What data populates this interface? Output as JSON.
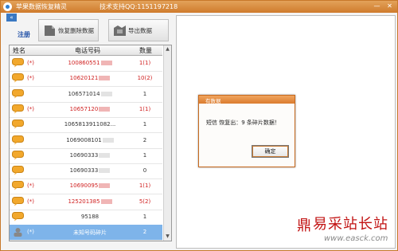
{
  "window": {
    "title": "苹果数据恢复精灵",
    "support": "技术支持QQ:1151197218",
    "minimize_glyph": "—",
    "close_glyph": "✕"
  },
  "toolbar": {
    "collapse_glyph": "«",
    "register_label": "注册",
    "restore_label": "恢复删除数据",
    "export_label": "导出数据"
  },
  "table": {
    "headers": [
      "姓名",
      "电话号码",
      "数量"
    ],
    "rows": [
      {
        "flag": "(*)",
        "phone": "100860551",
        "count": "1(1)",
        "red": true,
        "selected": false
      },
      {
        "flag": "(*)",
        "phone": "10620121",
        "count": "10(2)",
        "red": true,
        "selected": false
      },
      {
        "flag": "",
        "phone": "106571014",
        "count": "1",
        "red": false,
        "selected": false
      },
      {
        "flag": "(*)",
        "phone": "10657120",
        "count": "1(1)",
        "red": true,
        "selected": false
      },
      {
        "flag": "",
        "phone": "1065813911082...",
        "count": "1",
        "red": false,
        "selected": false
      },
      {
        "flag": "",
        "phone": "1069008101",
        "count": "2",
        "red": false,
        "selected": false
      },
      {
        "flag": "",
        "phone": "10690333",
        "count": "1",
        "red": false,
        "selected": false
      },
      {
        "flag": "",
        "phone": "10690333",
        "count": "0",
        "red": false,
        "selected": false
      },
      {
        "flag": "(*)",
        "phone": "10690095",
        "count": "1(1)",
        "red": true,
        "selected": false
      },
      {
        "flag": "(*)",
        "phone": "125201385",
        "count": "5(2)",
        "red": true,
        "selected": false
      },
      {
        "flag": "",
        "phone": "95188",
        "count": "1",
        "red": false,
        "selected": false
      },
      {
        "flag": "(*)",
        "phone": "未知号码碎片",
        "count": "2",
        "red": false,
        "selected": true
      }
    ],
    "scroll_up_glyph": "▲",
    "scroll_down_glyph": "▼"
  },
  "dialog": {
    "title": "有数据",
    "message": "短信 恢复出：9 条碎片数据！",
    "ok_label": "确定"
  },
  "watermark": {
    "text": "易采站长站",
    "url": "www.easck.com",
    "logo_glyph": "鼎"
  },
  "colors": {
    "accent": "#cf7b2c",
    "red_text": "#d02020",
    "selection": "#7eb4ea",
    "link_blue": "#1f4fa6"
  }
}
